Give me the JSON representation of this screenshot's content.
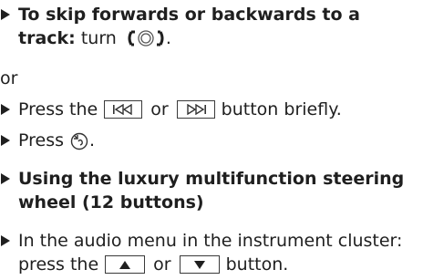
{
  "step_skip": {
    "heading_line1": "To skip forwards or backwards to a",
    "heading_bold2": "track:",
    "heading_rest2": " turn ",
    "heading_end": "."
  },
  "or_label": "or",
  "step_press_buttons": {
    "before": "Press the",
    "or": "or",
    "after": "button briefly."
  },
  "step_press_knob": {
    "before": "Press",
    "after": "."
  },
  "step_luxury": {
    "heading_line1": "Using the luxury multifunction steering",
    "heading_line2": "wheel (12 buttons)"
  },
  "step_audio_menu": {
    "line1": "In the audio menu in the instrument cluster:",
    "line2_before": "press the",
    "line2_or": "or",
    "line2_after": "button."
  },
  "icons": {
    "bullet": "triangle-bullet",
    "rotary": "rotary-controller-icon",
    "skip_back": "skip-back-icon",
    "skip_forward": "skip-forward-icon",
    "press_controller": "press-controller-icon",
    "up": "up-arrow-icon",
    "down": "down-arrow-icon"
  }
}
